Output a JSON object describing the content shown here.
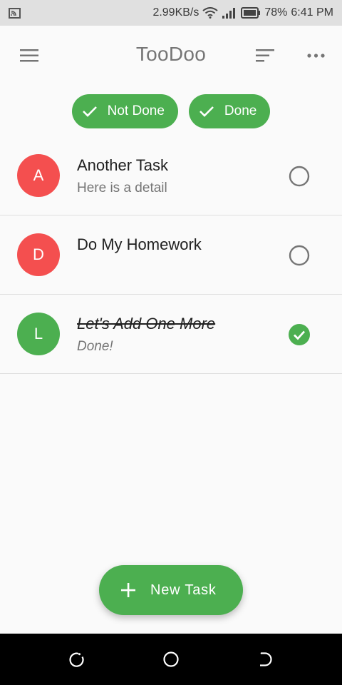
{
  "status_bar": {
    "network_speed": "2.99KB/s",
    "battery": "78%",
    "time": "6:41 PM",
    "icons": [
      "screencast-icon",
      "wifi-icon",
      "signal-icon",
      "battery-icon"
    ]
  },
  "app_bar": {
    "title": "TooDoo",
    "icons": [
      "menu-icon",
      "sort-icon",
      "more-icon"
    ]
  },
  "filters": [
    {
      "label": "Not Done",
      "selected": true
    },
    {
      "label": "Done",
      "selected": true
    }
  ],
  "tasks": [
    {
      "initial": "A",
      "title": "Another Task",
      "detail": "Here is a detail",
      "done": false,
      "color": "#f44f4f"
    },
    {
      "initial": "D",
      "title": "Do My Homework",
      "detail": "",
      "done": false,
      "color": "#f44f4f"
    },
    {
      "initial": "L",
      "title": "Let's Add One More",
      "detail": "Done!",
      "done": true,
      "color": "#4caf50"
    }
  ],
  "fab": {
    "label": "New Task"
  },
  "colors": {
    "accent": "#4caf50",
    "not_done_avatar": "#f44f4f",
    "status_bar_bg": "#e0e0e0",
    "background": "#fafafa"
  }
}
